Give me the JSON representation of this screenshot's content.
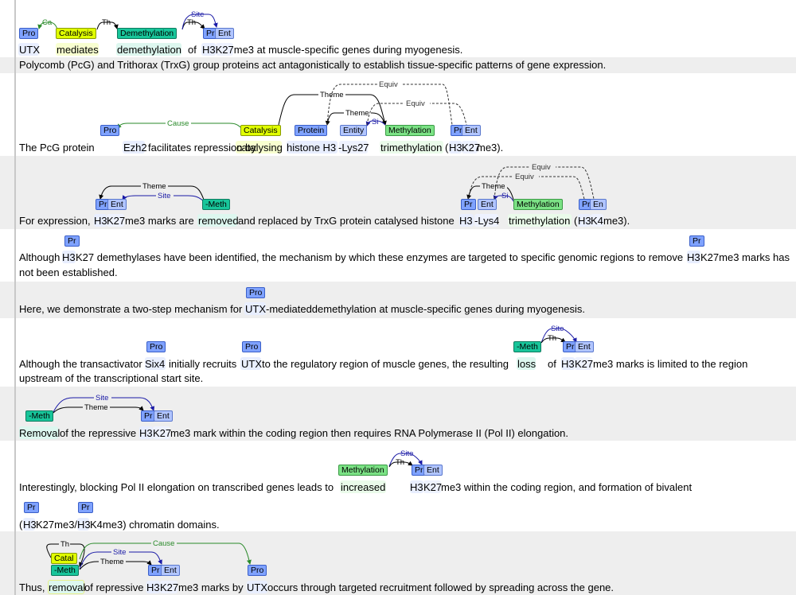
{
  "colors": {
    "protein": "#7fa2ff",
    "entity": "#b1c5ff",
    "catalysis": "#e0ff00",
    "demethylation": "#18c59a",
    "methylation": "#7be285",
    "row_alt_bg": "#eeeeee",
    "arc_theme": "#000000",
    "arc_site": "#1a1aa6",
    "arc_cause": "#2a8a2a",
    "arc_equiv": "#333333"
  },
  "sentences": [
    {
      "text_before": "",
      "tokens": [
        "UTX",
        "mediates",
        "demethylation",
        "of",
        "H3K27me3 at muscle-specific genes during myogenesis."
      ],
      "labels": [
        "Pro",
        "Catalysis",
        "Demethylation",
        "Pr",
        "Ent"
      ],
      "arcs": [
        "Ca",
        "Th",
        "Th",
        "Site"
      ]
    },
    {
      "text": "Polycomb (PcG) and Trithorax (TrxG) group proteins act antagonistically to establish tissue-specific patterns of gene expression."
    },
    {
      "tokens": [
        "The PcG protein",
        "Ezh2",
        "facilitates repression by",
        "catalysing",
        "histone H3",
        "-Lys27",
        "trimethylation",
        "(",
        "H3",
        "K27",
        "me3)."
      ],
      "labels": [
        "Pro",
        "Catalysis",
        "Protein",
        "Entity",
        "Methylation",
        "Pr",
        "Ent"
      ],
      "arcs": [
        "Cause",
        "Theme",
        "Theme",
        "Si",
        "Equiv",
        "Equiv"
      ]
    },
    {
      "tokens": [
        "For expression,",
        "H3",
        "K27",
        "me3 marks are",
        "removed",
        "and replaced by TrxG protein catalysed histone",
        "H3",
        "-Lys4",
        "trimethylation",
        "(",
        "H3",
        "K4",
        "me3)."
      ],
      "labels": [
        "Pr",
        "Ent",
        "-Meth",
        "Pr",
        "Ent",
        "Methylation",
        "Pr",
        "En"
      ],
      "arcs": [
        "Theme",
        "Site",
        "Theme",
        "Si",
        "Equiv",
        "Equiv"
      ]
    },
    {
      "line1": [
        "Although",
        "H3",
        "K27 demethylases have been identified, the mechanism by which these enzymes are targeted to specific genomic regions to remove",
        "H3",
        "K27me3 marks has"
      ],
      "line2": "not been established.",
      "labels": [
        "Pr",
        "Pr"
      ]
    },
    {
      "tokens": [
        "Here, we demonstrate a two-step mechanism for",
        "UTX",
        "-mediateddemethylation at muscle-specific genes during myogenesis."
      ],
      "labels": [
        "Pro"
      ]
    },
    {
      "line1": [
        "Although the transactivator",
        "Six4",
        "initially recruits",
        "UTX",
        "to the regulatory region of muscle genes, the resulting",
        "loss",
        "of",
        "H3",
        "K27",
        "me3 marks is limited to the region"
      ],
      "line2": "upstream of the transcriptional start site.",
      "labels": [
        "Pro",
        "Pro",
        "-Meth",
        "Pr",
        "Ent"
      ],
      "arcs": [
        "Site",
        "Th"
      ]
    },
    {
      "tokens": [
        "Removal",
        "of the repressive",
        "H3",
        "K27",
        "me3 mark within the coding region then requires RNA Polymerase II (Pol II) elongation."
      ],
      "labels": [
        "-Meth",
        "Pr",
        "Ent"
      ],
      "arcs": [
        "Site",
        "Theme"
      ]
    },
    {
      "line1": [
        "Interestingly, blocking Pol II elongation on transcribed genes leads to",
        "increased",
        "H3",
        "K27",
        "me3 within the coding region, and formation of bivalent"
      ],
      "line2": [
        "(",
        "H3",
        "K27me3/",
        "H3",
        "K4me3) chromatin domains."
      ],
      "labels": [
        "Methylation",
        "Pr",
        "Ent",
        "Pr",
        "Pr"
      ],
      "arcs": [
        "Site",
        "Th"
      ]
    },
    {
      "tokens": [
        "Thus,",
        "removal",
        "of repressive",
        "H3",
        "K27",
        "me3 marks by",
        "UTX",
        "occurs through targeted recruitment followed by spreading across the gene."
      ],
      "labels": [
        "Catal",
        "-Meth",
        "Pr",
        "Ent",
        "Pro"
      ],
      "arcs": [
        "Th",
        "Cause",
        "Site",
        "Theme"
      ]
    }
  ]
}
